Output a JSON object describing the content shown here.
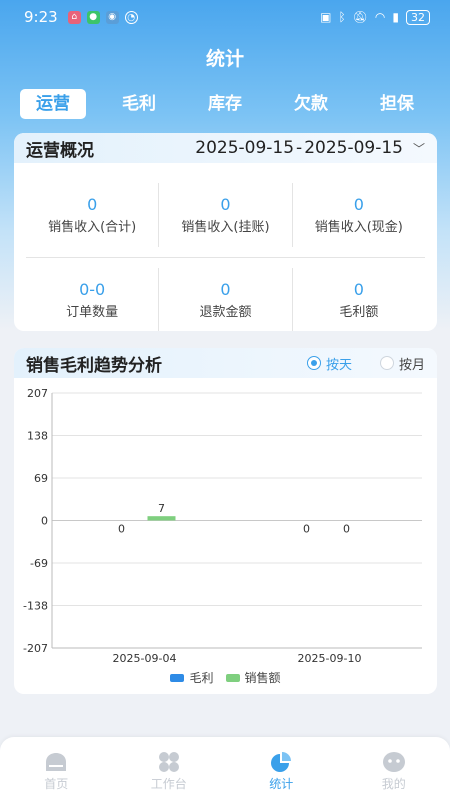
{
  "status_bar": {
    "time": "9:23",
    "battery": "32"
  },
  "page_title": "统计",
  "tabs": [
    {
      "label": "运营",
      "active": true
    },
    {
      "label": "毛利",
      "active": false
    },
    {
      "label": "库存",
      "active": false
    },
    {
      "label": "欠款",
      "active": false
    },
    {
      "label": "担保",
      "active": false
    }
  ],
  "overview": {
    "title": "运营概况",
    "date_start": "2025-09-15",
    "date_sep": "-",
    "date_end": "2025-09-15",
    "stats": [
      {
        "value": "0",
        "label": "销售收入(合计)"
      },
      {
        "value": "0",
        "label": "销售收入(挂账)"
      },
      {
        "value": "0",
        "label": "销售收入(现金)"
      },
      {
        "value": "0-0",
        "label": "订单数量"
      },
      {
        "value": "0",
        "label": "退款金额"
      },
      {
        "value": "0",
        "label": "毛利额"
      }
    ]
  },
  "trend": {
    "title": "销售毛利趋势分析",
    "radio_day": "按天",
    "radio_month": "按月",
    "selected": "day"
  },
  "chart_data": {
    "type": "bar",
    "categories": [
      "2025-09-04",
      "2025-09-10"
    ],
    "series": [
      {
        "name": "毛利",
        "values": [
          0,
          0
        ],
        "color": "#2e8be6"
      },
      {
        "name": "销售额",
        "values": [
          7,
          0
        ],
        "color": "#7fcf7f"
      }
    ],
    "ylim": [
      -207,
      207
    ],
    "yticks": [
      "207",
      "138",
      "69",
      "0",
      "-69",
      "-138",
      "-207"
    ],
    "ytick_values": [
      207,
      138,
      69,
      0,
      -69,
      -138,
      -207
    ],
    "legend": "bottom-center",
    "grid": true
  },
  "nav": [
    {
      "label": "首页",
      "active": false,
      "icon": "home-icon"
    },
    {
      "label": "工作台",
      "active": false,
      "icon": "grid-icon"
    },
    {
      "label": "统计",
      "active": true,
      "icon": "pie-chart-icon"
    },
    {
      "label": "我的",
      "active": false,
      "icon": "user-icon"
    }
  ],
  "colors": {
    "accent": "#3aa0ea"
  }
}
